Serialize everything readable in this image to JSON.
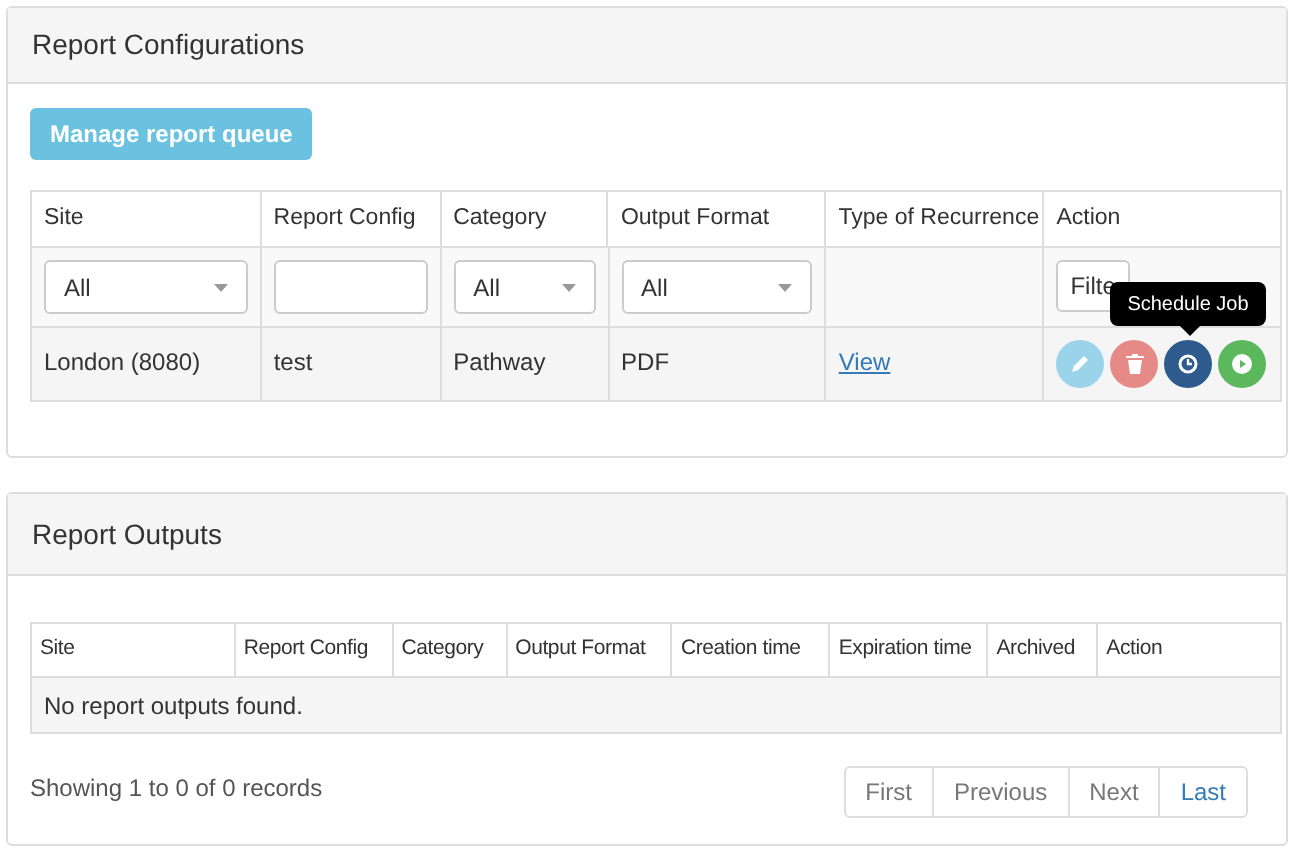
{
  "config_panel": {
    "title": "Report Configurations",
    "manage_button": "Manage report queue",
    "table": {
      "columns": [
        "Site",
        "Report Config",
        "Category",
        "Output Format",
        "Type of Recurrence",
        "Action"
      ],
      "filters": [
        {
          "kind": "select",
          "value": "All"
        },
        {
          "kind": "text"
        },
        {
          "kind": "select",
          "value": "All"
        },
        {
          "kind": "select",
          "value": "All"
        },
        {
          "kind": "none"
        },
        {
          "kind": "button",
          "label": "Filte"
        }
      ],
      "rows": [
        {
          "site": "London (8080)",
          "report_config": "test",
          "category": "Pathway",
          "output_format": "PDF",
          "recurrence_link": "View",
          "actions": [
            {
              "kind": "edit",
              "color": "#9bd3ea"
            },
            {
              "kind": "delete",
              "color": "#e58a87"
            },
            {
              "kind": "schedule",
              "color": "#2d5b8d"
            },
            {
              "kind": "run",
              "color": "#5cb85c"
            }
          ]
        }
      ]
    },
    "tooltip": "Schedule Job"
  },
  "outputs_panel": {
    "title": "Report Outputs",
    "table": {
      "columns": [
        "Site",
        "Report Config",
        "Category",
        "Output Format",
        "Creation time",
        "Expiration time",
        "Archived",
        "Action"
      ],
      "empty_message": "No report outputs found."
    },
    "summary": "Showing 1 to 0 of 0 records",
    "pagination": [
      {
        "label": "First",
        "disabled": true
      },
      {
        "label": "Previous",
        "disabled": true
      },
      {
        "label": "Next",
        "disabled": true
      },
      {
        "label": "Last",
        "disabled": false
      }
    ]
  }
}
